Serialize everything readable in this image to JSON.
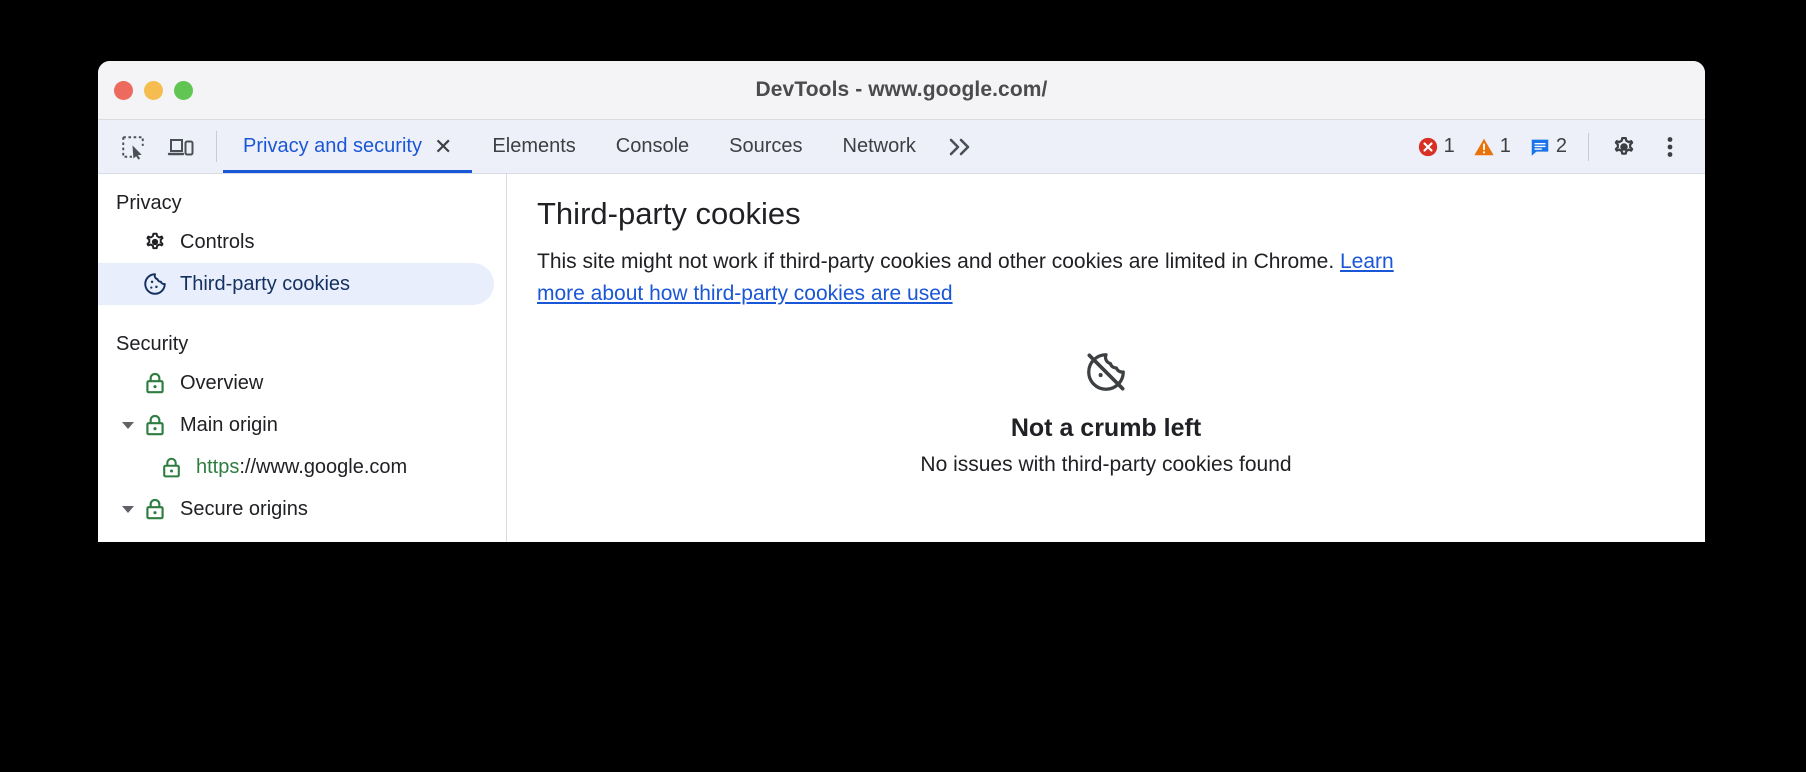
{
  "window": {
    "title": "DevTools - www.google.com/",
    "traffic_lights": [
      "close",
      "minimize",
      "maximize"
    ]
  },
  "toolbar": {
    "inspect_icon": "inspect-element-icon",
    "device_icon": "device-toolbar-icon",
    "overflow_label": "»",
    "settings_icon": "gear-icon",
    "menu_icon": "more-vertical-icon",
    "status": [
      {
        "icon": "error-icon",
        "count": "1",
        "color": "#d93025"
      },
      {
        "icon": "warning-icon",
        "count": "1",
        "color": "#e8710a"
      },
      {
        "icon": "message-icon",
        "count": "2",
        "color": "#1a73e8"
      }
    ]
  },
  "tabs": [
    {
      "label": "Privacy and security",
      "active": true,
      "closable": true,
      "close_label": "✕"
    },
    {
      "label": "Elements",
      "active": false,
      "closable": false
    },
    {
      "label": "Console",
      "active": false,
      "closable": false
    },
    {
      "label": "Sources",
      "active": false,
      "closable": false
    },
    {
      "label": "Network",
      "active": false,
      "closable": false
    }
  ],
  "sidebar": {
    "privacy_section": "Privacy",
    "privacy_items": [
      {
        "label": "Controls",
        "icon": "gear-icon",
        "selected": false
      },
      {
        "label": "Third-party cookies",
        "icon": "cookie-icon",
        "selected": true
      }
    ],
    "security_section": "Security",
    "security_items": [
      {
        "label": "Overview",
        "icon": "lock-icon",
        "expandable": false
      },
      {
        "label": "Main origin",
        "icon": "lock-icon",
        "expandable": true
      },
      {
        "label": "https://www.google.com",
        "url_scheme": "https",
        "url_rest": "://www.google.com",
        "icon": "lock-icon",
        "child": true
      },
      {
        "label": "Secure origins",
        "icon": "lock-icon",
        "expandable": true
      }
    ]
  },
  "main": {
    "title": "Third-party cookies",
    "description_part1": "This site might not work if third-party cookies and other cookies are limited in Chrome. ",
    "link_text": "Learn more about how third-party cookies are used",
    "empty_icon": "cookie-off-icon",
    "empty_title": "Not a crumb left",
    "empty_subtitle": "No issues with third-party cookies found"
  },
  "colors": {
    "accent": "#1a57d6",
    "selected_bg": "#e8eefc",
    "lock_green": "#2e7d41",
    "error": "#d93025",
    "warning": "#e8710a",
    "info": "#1a73e8"
  }
}
